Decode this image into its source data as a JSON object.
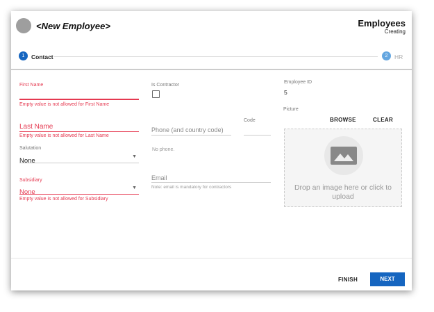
{
  "header": {
    "title": "<New Employee>",
    "app_title": "Employees",
    "status": "Creating"
  },
  "steps": [
    {
      "number": "1",
      "label": "Contact"
    },
    {
      "number": "2",
      "label": "HR"
    }
  ],
  "form": {
    "first_name": {
      "label": "First Name",
      "value": "",
      "error": "Empty value is not allowed for First Name"
    },
    "last_name": {
      "placeholder": "Last Name",
      "error": "Empty value is not allowed for Last Name"
    },
    "salutation": {
      "label": "Salutation",
      "value": "None"
    },
    "subsidiary": {
      "label": "Subsidiary",
      "value": "None",
      "error": "Empty value is not allowed for Subsidiary"
    },
    "is_contractor": {
      "label": "Is Contractor",
      "checked": false
    },
    "phone": {
      "placeholder": "Phone (and country code)",
      "hint": "No phone."
    },
    "code": {
      "label": "Code"
    },
    "email": {
      "placeholder": "Email",
      "hint": "Note: email is mandatory for contractors"
    },
    "employee_id": {
      "label": "Employee ID",
      "value": "5"
    },
    "picture": {
      "label": "Picture",
      "browse": "BROWSE",
      "clear": "CLEAR",
      "drop_text": "Drop an image here or click to upload",
      "icon": "image-icon"
    }
  },
  "footer": {
    "finish": "FINISH",
    "next": "NEXT"
  },
  "colors": {
    "accent": "#1565c0",
    "error": "#e53950"
  }
}
